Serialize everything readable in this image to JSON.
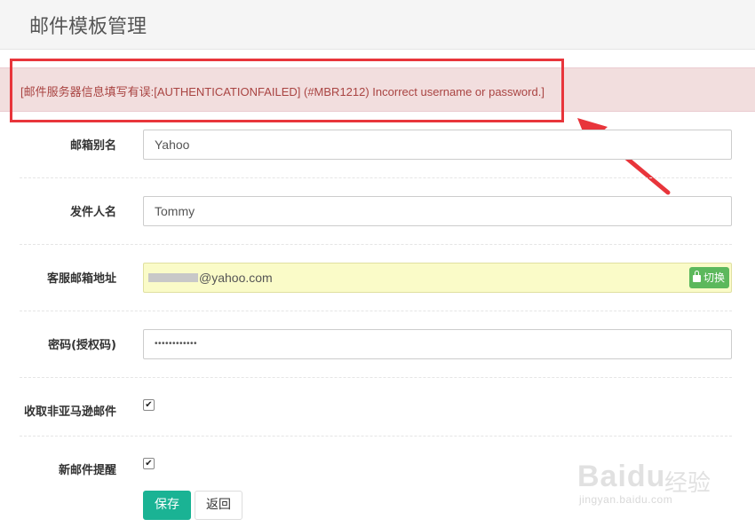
{
  "page": {
    "title": "邮件模板管理"
  },
  "alert": {
    "message": "[邮件服务器信息填写有误:[AUTHENTICATIONFAILED] (#MBR1212) Incorrect username or password.]"
  },
  "form": {
    "mailbox_alias": {
      "label": "邮箱别名",
      "value": "Yahoo"
    },
    "sender_name": {
      "label": "发件人名",
      "value": "Tommy"
    },
    "service_email": {
      "label": "客服邮箱地址",
      "value": "@yahoo.com",
      "switch_label": "切换"
    },
    "password": {
      "label": "密码(授权码)",
      "value": "••••••••••••"
    },
    "receive_non_amazon": {
      "label": "收取非亚马逊邮件",
      "checked": true
    },
    "new_mail_alert": {
      "label": "新邮件提醒",
      "checked": true
    }
  },
  "buttons": {
    "save": "保存",
    "back": "返回"
  },
  "watermark": {
    "brand": "Baidu",
    "cn": "经验",
    "url": "jingyan.baidu.com"
  },
  "colors": {
    "alert_text": "#a94442",
    "alert_bg": "#f2dede",
    "highlight": "#e8353b",
    "primary": "#1ab394",
    "success": "#5cb85c"
  }
}
